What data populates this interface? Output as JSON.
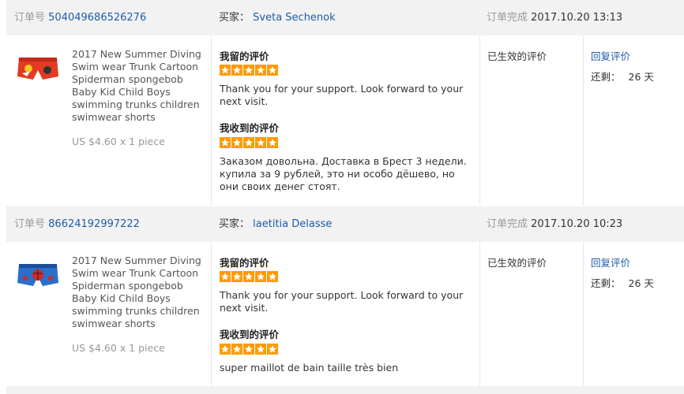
{
  "labels": {
    "order_no": "订单号",
    "buyer": "买家：",
    "completed": "订单完成",
    "my_review": "我留的评价",
    "received_review": "我收到的评价",
    "effective": "已生效的评价",
    "reply": "回复评价",
    "remaining": "还剩："
  },
  "colors": {
    "star": "#ff9a00",
    "link": "#1f5ba8",
    "header_bg": "#f2f2f2"
  },
  "orders": [
    {
      "order_number": "504049686526276",
      "buyer": "Sveta Sechenok",
      "completed_time": "2017.10.20 13:13",
      "product_title": "2017 New Summer Diving Swim wear Trunk Cartoon Spiderman spongebob Baby Kid Child Boys swimming trunks children swimwear shorts",
      "price": "US $4.60 x 1 piece",
      "my_review_stars": 5,
      "my_review_text": "Thank you for your support. Look forward to your next visit.",
      "received_review_stars": 5,
      "received_review_text": "Заказом довольна. Доставка в Брест 3 недели. купила за 9 рублей, это ни особо дёшево, но они своих денег стоят.",
      "remaining_days": "26 天",
      "thumb_icon": "swim-trunks-red-icon"
    },
    {
      "order_number": "86624192997222",
      "buyer": "laetitia Delasse",
      "completed_time": "2017.10.20 10:23",
      "product_title": "2017 New Summer Diving Swim wear Trunk Cartoon Spiderman spongebob Baby Kid Child Boys swimming trunks children swimwear shorts",
      "price": "US $4.60 x 1 piece",
      "my_review_stars": 5,
      "my_review_text": "Thank you for your support. Look forward to your next visit.",
      "received_review_stars": 5,
      "received_review_text": "super maillot de bain taille très bien",
      "remaining_days": "26 天",
      "thumb_icon": "swim-trunks-blue-icon"
    }
  ]
}
